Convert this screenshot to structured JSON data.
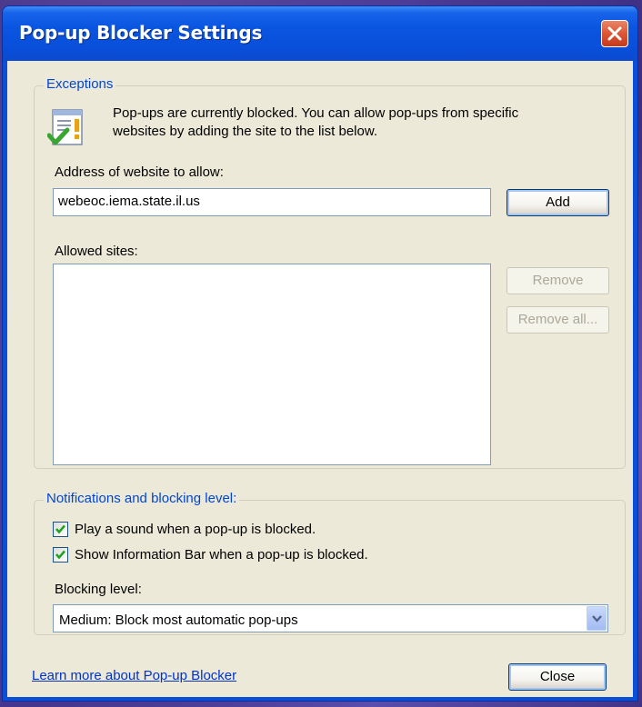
{
  "window": {
    "title": "Pop-up Blocker Settings"
  },
  "exceptions": {
    "group_title": "Exceptions",
    "description_line1": "Pop-ups are currently blocked.  You can allow pop-ups from specific",
    "description_line2": "websites by adding the site to the list below.",
    "address_label": "Address of website to allow:",
    "address_value": "webeoc.iema.state.il.us",
    "add_label": "Add",
    "allowed_label": "Allowed sites:",
    "allowed_sites": [],
    "remove_label": "Remove",
    "remove_all_label": "Remove all..."
  },
  "notifications": {
    "group_title": "Notifications and blocking level:",
    "play_sound_label": "Play a sound when a pop-up is blocked.",
    "play_sound_checked": true,
    "info_bar_label": "Show Information Bar when a pop-up is blocked.",
    "info_bar_checked": true,
    "blocking_level_label": "Blocking level:",
    "blocking_level_value": "Medium: Block most automatic pop-ups"
  },
  "footer": {
    "learn_more_label": "Learn more about Pop-up Blocker",
    "close_label": "Close"
  },
  "colors": {
    "titlebar": "#0a55e0",
    "dialog_face": "#ece9d8",
    "group_title": "#0046d5",
    "link": "#0033cc",
    "close_button": "#dd5a3a"
  },
  "icons": {
    "info_icon": "document-warning-check-icon",
    "close_icon": "close-icon",
    "dropdown_icon": "chevron-down-icon",
    "checkbox_icon": "checkmark-icon"
  }
}
